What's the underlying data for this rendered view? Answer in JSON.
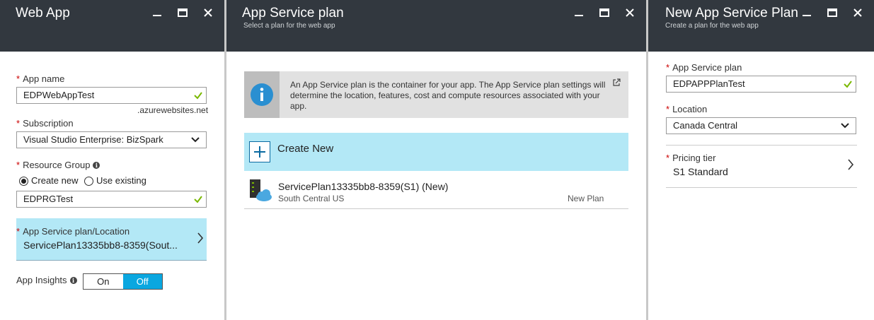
{
  "web_app": {
    "title": "Web App",
    "app_name_label": "App name",
    "app_name_value": "EDPWebAppTest",
    "domain_suffix": ".azurewebsites.net",
    "subscription_label": "Subscription",
    "subscription_value": "Visual Studio Enterprise: BizSpark",
    "resource_group_label": "Resource Group",
    "radio_create_new": "Create new",
    "radio_use_existing": "Use existing",
    "resource_group_value": "EDPRGTest",
    "plan_location_label": "App Service plan/Location",
    "plan_location_value": "ServicePlan13335bb8-8359(Sout...",
    "app_insights_label": "App Insights",
    "toggle_on": "On",
    "toggle_off": "Off"
  },
  "service_plan": {
    "title": "App Service plan",
    "subtitle": "Select a plan for the web app",
    "info_text": "An App Service plan is the container for your app. The App Service plan settings will determine the location, features, cost and compute resources associated with your app.",
    "create_new_label": "Create New",
    "plan_name": "ServicePlan13335bb8-8359(S1) (New)",
    "plan_region": "South Central US",
    "plan_badge": "New Plan"
  },
  "new_plan": {
    "title": "New App Service Plan",
    "subtitle": "Create a plan for the web app",
    "plan_label": "App Service plan",
    "plan_value": "EDPAPPPlanTest",
    "location_label": "Location",
    "location_value": "Canada Central",
    "pricing_label": "Pricing tier",
    "pricing_value": "S1 Standard"
  },
  "colors": {
    "header_bg": "#32383f",
    "selected_bg": "#b3e8f6",
    "accent": "#0aa7e0",
    "valid_check": "#7ab800",
    "required": "#cc0000"
  },
  "icons": [
    "minimize-icon",
    "maximize-icon",
    "close-icon",
    "check-icon",
    "chevron-down-icon",
    "chevron-right-icon",
    "info-icon",
    "plus-icon",
    "server-cloud-icon",
    "external-link-icon"
  ]
}
